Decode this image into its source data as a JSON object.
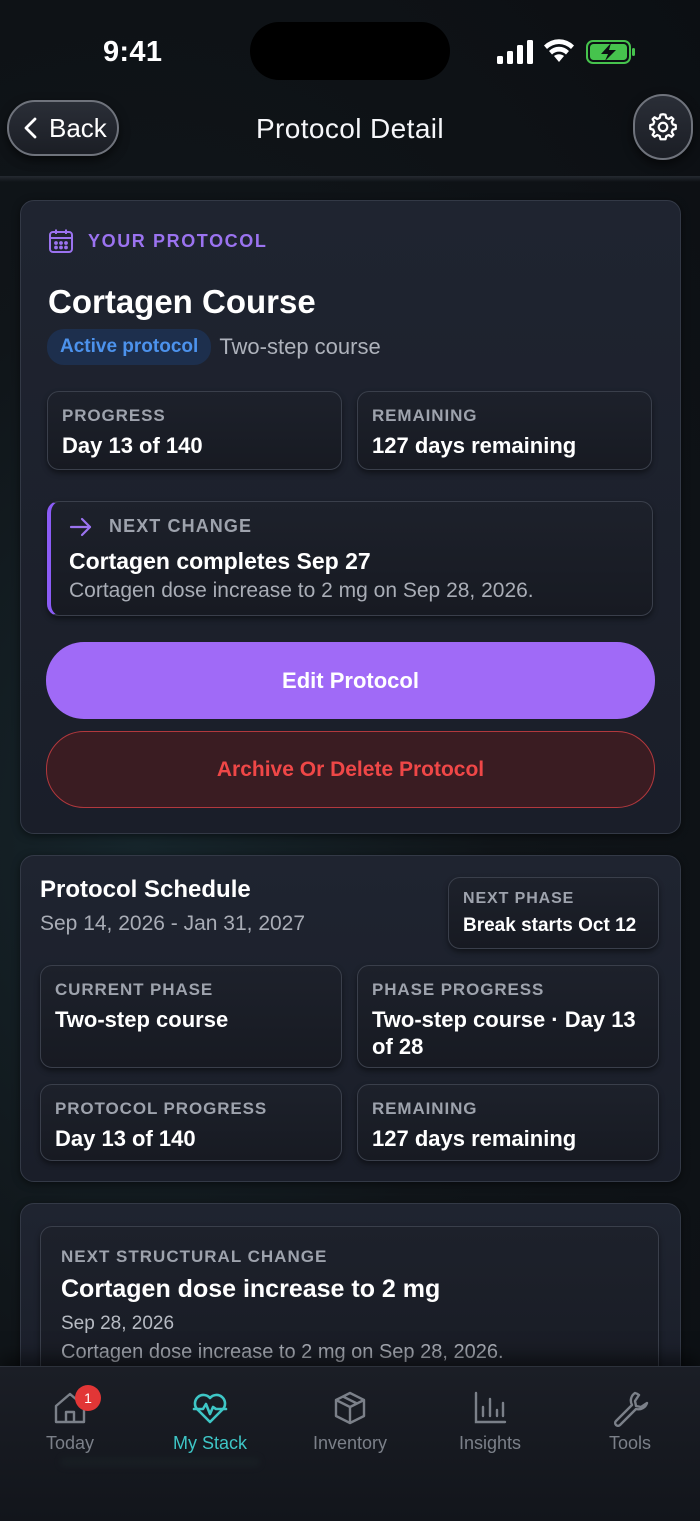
{
  "status_bar": {
    "time": "9:41"
  },
  "header": {
    "back_label": "Back",
    "title": "Protocol Detail"
  },
  "protocol_card": {
    "section_label": "YOUR PROTOCOL",
    "name": "Cortagen Course",
    "status_badge": "Active protocol",
    "course_type": "Two-step course",
    "progress": {
      "label": "PROGRESS",
      "value": "Day 13 of 140"
    },
    "remaining": {
      "label": "REMAINING",
      "value": "127 days remaining"
    },
    "next_change": {
      "label": "NEXT CHANGE",
      "title": "Cortagen completes Sep 27",
      "description": "Cortagen dose increase to 2 mg on Sep 28, 2026."
    },
    "edit_button": "Edit Protocol",
    "archive_button": "Archive Or Delete Protocol"
  },
  "schedule_card": {
    "title": "Protocol Schedule",
    "dates": "Sep 14, 2026 - Jan 31, 2027",
    "next_phase": {
      "label": "NEXT PHASE",
      "value": "Break starts Oct 12"
    },
    "current_phase": {
      "label": "CURRENT PHASE",
      "value": "Two-step course"
    },
    "phase_progress": {
      "label": "PHASE PROGRESS",
      "value": "Two-step course · Day 13 of 28"
    },
    "protocol_progress": {
      "label": "PROTOCOL PROGRESS",
      "value": "Day 13 of 140"
    },
    "remaining": {
      "label": "REMAINING",
      "value": "127 days remaining"
    }
  },
  "structural_card": {
    "label": "NEXT STRUCTURAL CHANGE",
    "title": "Cortagen dose increase to 2 mg",
    "date": "Sep 28, 2026",
    "description": "Cortagen dose increase to 2 mg on Sep 28, 2026."
  },
  "tab_bar": {
    "tabs": [
      {
        "label": "Today",
        "icon": "home-icon",
        "badge": "1"
      },
      {
        "label": "My Stack",
        "icon": "heart-pulse-icon",
        "active": true
      },
      {
        "label": "Inventory",
        "icon": "box-icon"
      },
      {
        "label": "Insights",
        "icon": "bar-chart-icon"
      },
      {
        "label": "Tools",
        "icon": "wrench-icon"
      }
    ]
  },
  "colors": {
    "accent_purple": "#a06af7",
    "active_tab": "#3ec6c6",
    "danger": "#ef4747",
    "badge_blue": "#4c92ec"
  }
}
